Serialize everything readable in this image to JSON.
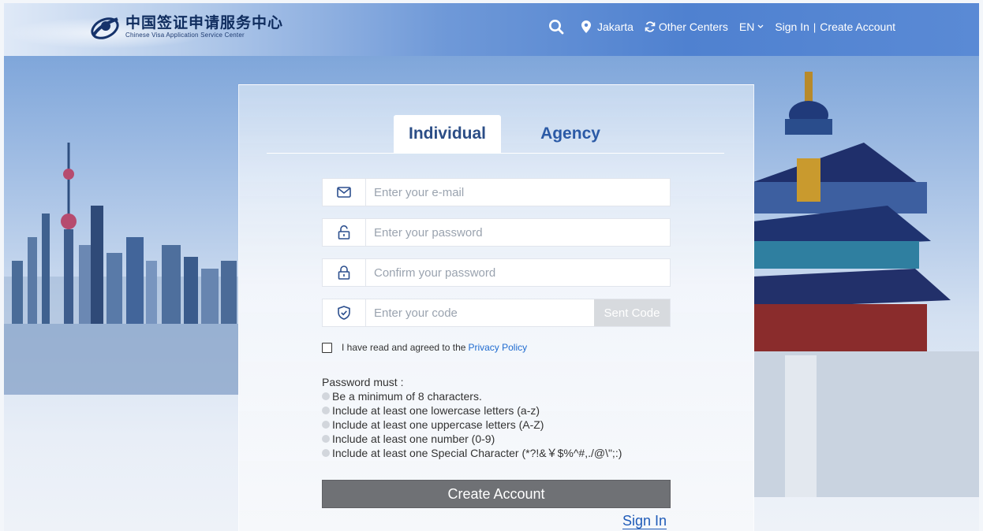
{
  "header": {
    "logo_cn": "中国签证申请服务中心",
    "logo_en": "Chinese Visa Application Service Center",
    "nav": {
      "search_icon": "search-icon",
      "location_icon": "map-pin-icon",
      "city": "Jakarta",
      "refresh_icon": "refresh-icon",
      "other_centers": "Other Centers",
      "language": "EN",
      "sign_in": "Sign In",
      "separator": "|",
      "create_account": "Create Account"
    }
  },
  "form": {
    "tabs": [
      {
        "label": "Individual",
        "active": true
      },
      {
        "label": "Agency",
        "active": false
      }
    ],
    "fields": {
      "email": {
        "placeholder": "Enter your e-mail",
        "value": "",
        "icon": "mail-icon"
      },
      "password": {
        "placeholder": "Enter your password",
        "value": "",
        "icon": "unlock-icon"
      },
      "confirm_password": {
        "placeholder": "Confirm your password",
        "value": "",
        "icon": "lock-icon"
      },
      "code": {
        "placeholder": "Enter your code",
        "value": "",
        "icon": "shield-check-icon"
      }
    },
    "sent_code_label": "Sent Code",
    "agree_text": "I have read and agreed to the",
    "privacy_link": "Privacy Policy",
    "password_rules_title": "Password must :",
    "password_rules": [
      "Be a minimum of 8 characters.",
      "Include at least one lowercase letters (a-z)",
      "Include at least one uppercase letters (A-Z)",
      "Include at least one number (0-9)",
      "Include at least one Special Character (*?!&￥$%^#,./@\\\";:)"
    ],
    "create_button": "Create Account",
    "sign_in_link": "Sign In"
  },
  "colors": {
    "primary_text": "#2b4d86",
    "link": "#1f6bd0",
    "button_bg": "#6f7175",
    "header_blue": "#4f81d0"
  }
}
